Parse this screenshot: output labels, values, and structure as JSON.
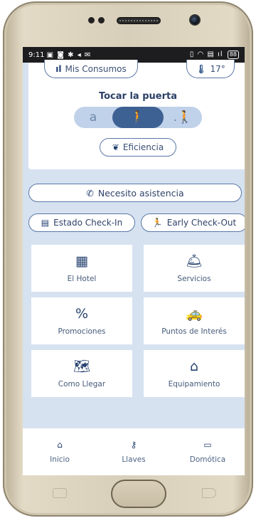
{
  "status_bar": {
    "time": "9:11",
    "left_icons": "▣ ◙ ✱ ◂ ✉",
    "right_icons": "▯ ◠ ▤ ıl",
    "battery": "88"
  },
  "top": {
    "consumos_label": "Mis Consumos",
    "temperature": "17°"
  },
  "door": {
    "title": "Tocar la puerta",
    "left_glyph": "a",
    "center_glyph": "🚶",
    "right_glyph": ".🚶"
  },
  "eficiencia_label": "Eficiencia",
  "assist_label": "Necesito asistencia",
  "checkin_label": "Estado Check-In",
  "checkout_label": "Early Check-Out",
  "tiles": [
    {
      "label": "El Hotel",
      "icon": "hotel-icon",
      "glyph": "▦"
    },
    {
      "label": "Servicios",
      "icon": "concierge-bell-icon",
      "glyph": "🛎"
    },
    {
      "label": "Promociones",
      "icon": "percent-icon",
      "glyph": "%"
    },
    {
      "label": "Puntos de Interés",
      "icon": "taxi-icon",
      "glyph": "🚕"
    },
    {
      "label": "Como Llegar",
      "icon": "map-marker-icon",
      "glyph": "🗺"
    },
    {
      "label": "Equipamiento",
      "icon": "house-icon",
      "glyph": "⌂"
    }
  ],
  "nav": [
    {
      "label": "Inicio",
      "icon": "home-icon",
      "glyph": "⌂"
    },
    {
      "label": "Llaves",
      "icon": "key-icon",
      "glyph": "⚷"
    },
    {
      "label": "Domótica",
      "icon": "bed-icon",
      "glyph": "▭"
    }
  ],
  "colors": {
    "accent": "#3d6192",
    "background": "#d6e2f0",
    "border": "#5a78a8"
  }
}
